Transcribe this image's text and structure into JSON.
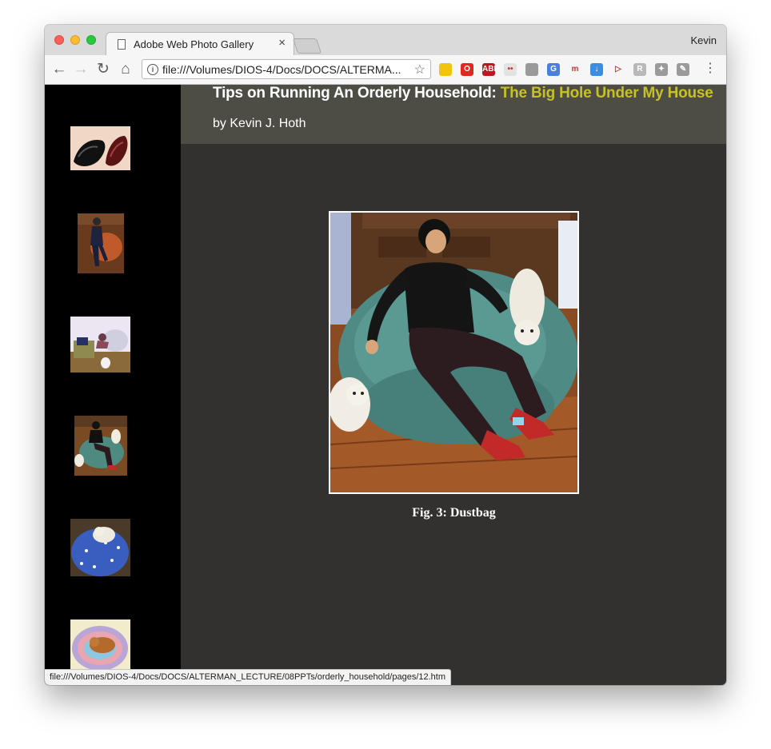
{
  "browser": {
    "tab_title": "Adobe Web Photo Gallery",
    "tab_close": "×",
    "profile_name": "Kevin",
    "url": "file:///Volumes/DIOS-4/Docs/DOCS/ALTERMA...",
    "status_url": "file:///Volumes/DIOS-4/Docs/DOCS/ALTERMAN_LECTURE/08PPTs/orderly_household/pages/12.htm",
    "extensions": [
      {
        "name": "glasses-extension-icon",
        "label": "",
        "color": "#f1c40f"
      },
      {
        "name": "opera-extension-icon",
        "label": "O",
        "color": "#e0281f"
      },
      {
        "name": "adblock-extension-icon",
        "label": "ABP",
        "color": "#c0161d"
      },
      {
        "name": "flickr-extension-icon",
        "label": "••",
        "color": "#e3e3e3"
      },
      {
        "name": "drive-extension-icon",
        "label": "",
        "color": "#9a9a9a"
      },
      {
        "name": "translate-extension-icon",
        "label": "G",
        "color": "#4a7fe0"
      },
      {
        "name": "m-extension-icon",
        "label": "m",
        "color": "#f6f6f6"
      },
      {
        "name": "download-extension-icon",
        "label": "↓",
        "color": "#3a8de0"
      },
      {
        "name": "arrow-extension-icon",
        "label": "▷",
        "color": "#f6f6f6"
      },
      {
        "name": "r-extension-icon",
        "label": "R",
        "color": "#b8b8b8"
      },
      {
        "name": "satellite-extension-icon",
        "label": "✦",
        "color": "#9a9a9a"
      },
      {
        "name": "wrench-extension-icon",
        "label": "✎",
        "color": "#9a9a9a"
      }
    ]
  },
  "page": {
    "title_main": "Tips on Running An Orderly Household: ",
    "title_sub": "The Big Hole Under My House",
    "byline": "by Kevin J. Hoth",
    "caption": "Fig. 3: Dustbag",
    "colors": {
      "header_bg": "#4d4d46",
      "page_bg": "#323130",
      "accent": "#c6c225"
    }
  },
  "thumbnails": [
    {
      "name": "thumb-shoes"
    },
    {
      "name": "thumb-person-beanbag"
    },
    {
      "name": "thumb-dog-room"
    },
    {
      "name": "thumb-dustbag"
    },
    {
      "name": "thumb-dog-blue-bag"
    },
    {
      "name": "thumb-dog-bed"
    }
  ]
}
